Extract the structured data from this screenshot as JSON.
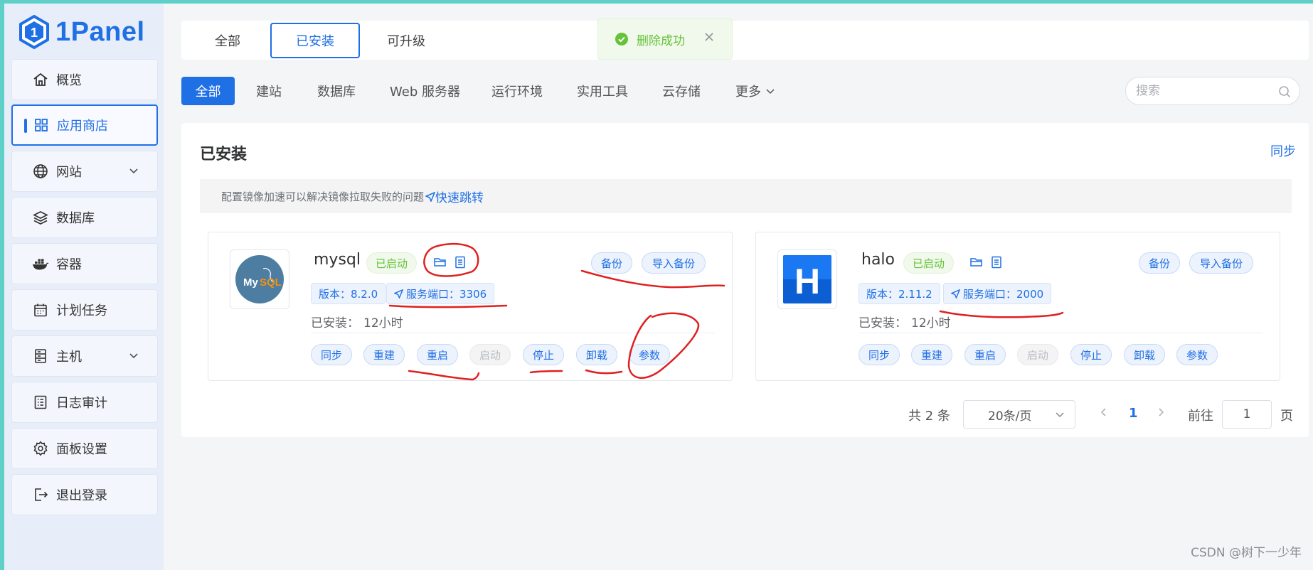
{
  "brand": {
    "name": "1Panel"
  },
  "sidebar": {
    "items": [
      {
        "label": "概览",
        "icon": "home-icon"
      },
      {
        "label": "应用商店",
        "icon": "grid-icon",
        "active": true
      },
      {
        "label": "网站",
        "icon": "globe-icon",
        "expandable": true
      },
      {
        "label": "数据库",
        "icon": "layers-icon"
      },
      {
        "label": "容器",
        "icon": "docker-icon"
      },
      {
        "label": "计划任务",
        "icon": "calendar-icon"
      },
      {
        "label": "主机",
        "icon": "server-icon",
        "expandable": true
      },
      {
        "label": "日志审计",
        "icon": "log-icon"
      },
      {
        "label": "面板设置",
        "icon": "gear-icon"
      },
      {
        "label": "退出登录",
        "icon": "logout-icon"
      }
    ]
  },
  "tabs": [
    {
      "label": "全部"
    },
    {
      "label": "已安装",
      "active": true
    },
    {
      "label": "可升级"
    }
  ],
  "toast": {
    "text": "删除成功",
    "type": "success"
  },
  "categories": [
    {
      "label": "全部",
      "active": true
    },
    {
      "label": "建站"
    },
    {
      "label": "数据库"
    },
    {
      "label": "Web 服务器"
    },
    {
      "label": "运行环境"
    },
    {
      "label": "实用工具"
    },
    {
      "label": "云存储"
    },
    {
      "label": "更多"
    }
  ],
  "search": {
    "placeholder": "搜索",
    "value": ""
  },
  "main": {
    "title": "已安装",
    "sync_label": "同步",
    "tip_text": "配置镜像加速可以解决镜像拉取失败的问题",
    "tip_link": "快速跳转"
  },
  "apps": [
    {
      "name": "mysql",
      "status": "已启动",
      "version": "版本：8.2.0",
      "port": "服务端口：3306",
      "installed_label": "已安装：",
      "installed_value": "12小时",
      "backup_label": "备份",
      "import_backup_label": "导入备份",
      "actions": [
        "同步",
        "重建",
        "重启",
        "启动",
        "停止",
        "卸载",
        "参数"
      ]
    },
    {
      "name": "halo",
      "status": "已启动",
      "version": "版本：2.11.2",
      "port": "服务端口：2000",
      "installed_label": "已安装：",
      "installed_value": "12小时",
      "backup_label": "备份",
      "import_backup_label": "导入备份",
      "actions": [
        "同步",
        "重建",
        "重启",
        "启动",
        "停止",
        "卸载",
        "参数"
      ]
    }
  ],
  "pagination": {
    "total": "共 2 条",
    "page_size": "20条/页",
    "current": "1",
    "goto_label": "前往",
    "goto_value": "1",
    "page_suffix": "页"
  },
  "watermark": "CSDN @树下一少年",
  "colors": {
    "accent": "#1f6fe5",
    "success": "#67c23a",
    "annotation": "#e02020"
  }
}
